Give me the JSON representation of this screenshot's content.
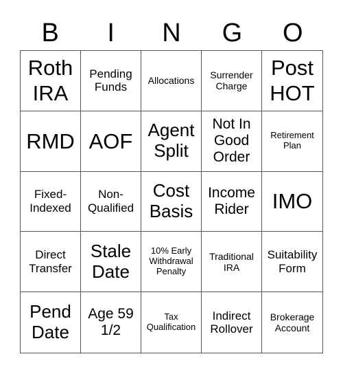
{
  "header": [
    "B",
    "I",
    "N",
    "G",
    "O"
  ],
  "cells": [
    {
      "text": "Roth IRA",
      "size": "xl"
    },
    {
      "text": "Pending Funds",
      "size": "s"
    },
    {
      "text": "Allocations",
      "size": "xs"
    },
    {
      "text": "Surrender Charge",
      "size": "xs"
    },
    {
      "text": "Post HOT",
      "size": "xl"
    },
    {
      "text": "RMD",
      "size": "xl"
    },
    {
      "text": "AOF",
      "size": "xl"
    },
    {
      "text": "Agent Split",
      "size": "l"
    },
    {
      "text": "Not In Good Order",
      "size": "m"
    },
    {
      "text": "Retirement Plan",
      "size": "xxs"
    },
    {
      "text": "Fixed-Indexed",
      "size": "s"
    },
    {
      "text": "Non-Qualified",
      "size": "s"
    },
    {
      "text": "Cost Basis",
      "size": "l"
    },
    {
      "text": "Income Rider",
      "size": "m"
    },
    {
      "text": "IMO",
      "size": "xl"
    },
    {
      "text": "Direct Transfer",
      "size": "s"
    },
    {
      "text": "Stale Date",
      "size": "l"
    },
    {
      "text": "10% Early Withdrawal Penalty",
      "size": "xxs"
    },
    {
      "text": "Traditional IRA",
      "size": "xs"
    },
    {
      "text": "Suitability Form",
      "size": "s"
    },
    {
      "text": "Pend Date",
      "size": "l"
    },
    {
      "text": "Age 59 1/2",
      "size": "m"
    },
    {
      "text": "Tax Qualification",
      "size": "xxs"
    },
    {
      "text": "Indirect Rollover",
      "size": "s"
    },
    {
      "text": "Brokerage Account",
      "size": "xs"
    }
  ]
}
